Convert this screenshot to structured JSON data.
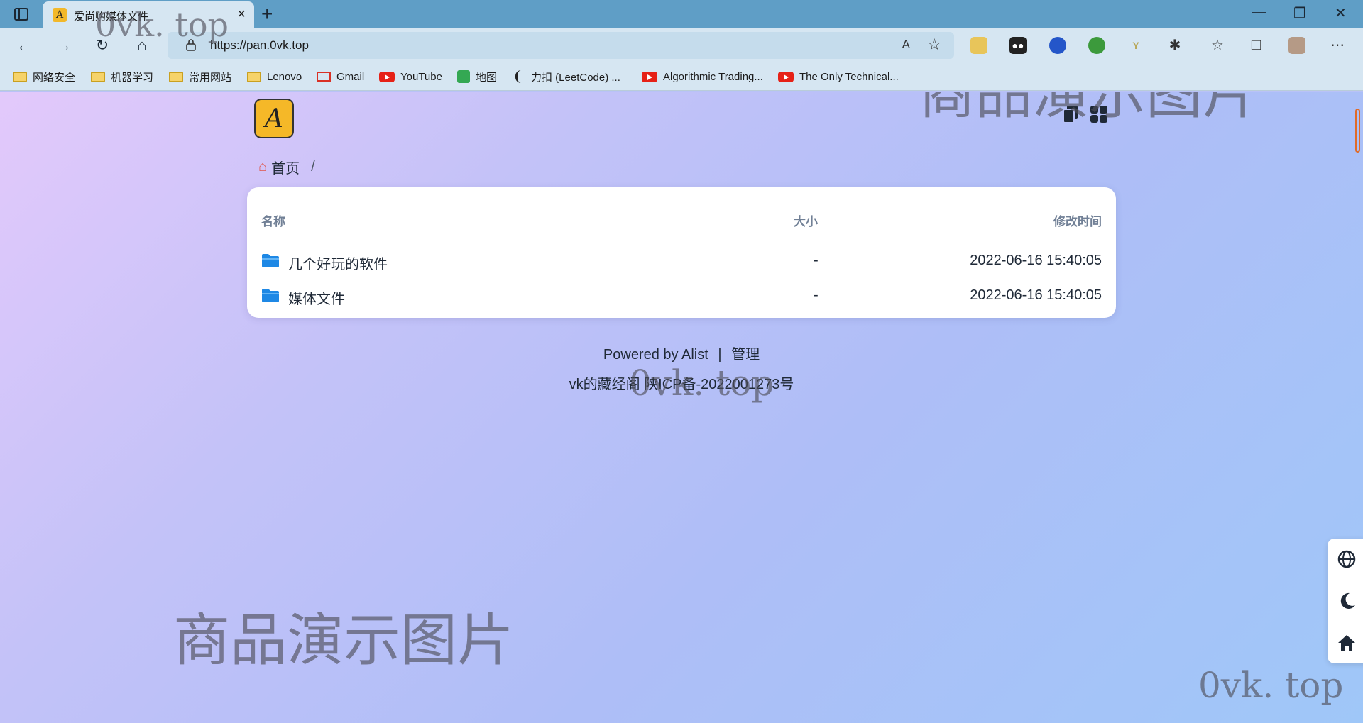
{
  "browser": {
    "tab_title": "爱尚购媒体文件",
    "url": "https://pan.0vk.top",
    "read_aloud": "A",
    "window_controls": {
      "minimize": "—",
      "restore": "❐",
      "close": "✕"
    }
  },
  "bookmarks": [
    {
      "label": "网络安全",
      "icon": "folder-icon"
    },
    {
      "label": "机器学习",
      "icon": "folder-icon"
    },
    {
      "label": "常用网站",
      "icon": "folder-icon"
    },
    {
      "label": "Lenovo",
      "icon": "folder-icon"
    },
    {
      "label": "Gmail",
      "icon": "gmail-icon"
    },
    {
      "label": "YouTube",
      "icon": "youtube-icon"
    },
    {
      "label": "地图",
      "icon": "maps-icon"
    },
    {
      "label": "力扣 (LeetCode) ...",
      "icon": "leetcode-icon"
    },
    {
      "label": "Algorithmic Trading...",
      "icon": "youtube-icon"
    },
    {
      "label": "The Only Technical...",
      "icon": "youtube-icon"
    }
  ],
  "breadcrumb": {
    "home": "首页",
    "separator": "/"
  },
  "table": {
    "headers": {
      "name": "名称",
      "size": "大小",
      "modified": "修改时间"
    },
    "rows": [
      {
        "name": "几个好玩的软件",
        "size": "-",
        "modified": "2022-06-16 15:40:05"
      },
      {
        "name": "媒体文件",
        "size": "-",
        "modified": "2022-06-16 15:40:05"
      }
    ]
  },
  "footer": {
    "powered": "Powered by Alist",
    "divider": "|",
    "manage": "管理",
    "icp": "vk的藏经阁 陕ICP备-2022001273号"
  },
  "watermarks": {
    "cn": "商品演示图片",
    "en": "0vk. top"
  },
  "colors": {
    "folder": "#1e88e5",
    "logo": "#f5b828",
    "accent_bg_start": "#e3c9fb",
    "accent_bg_end": "#9fc7f8"
  }
}
